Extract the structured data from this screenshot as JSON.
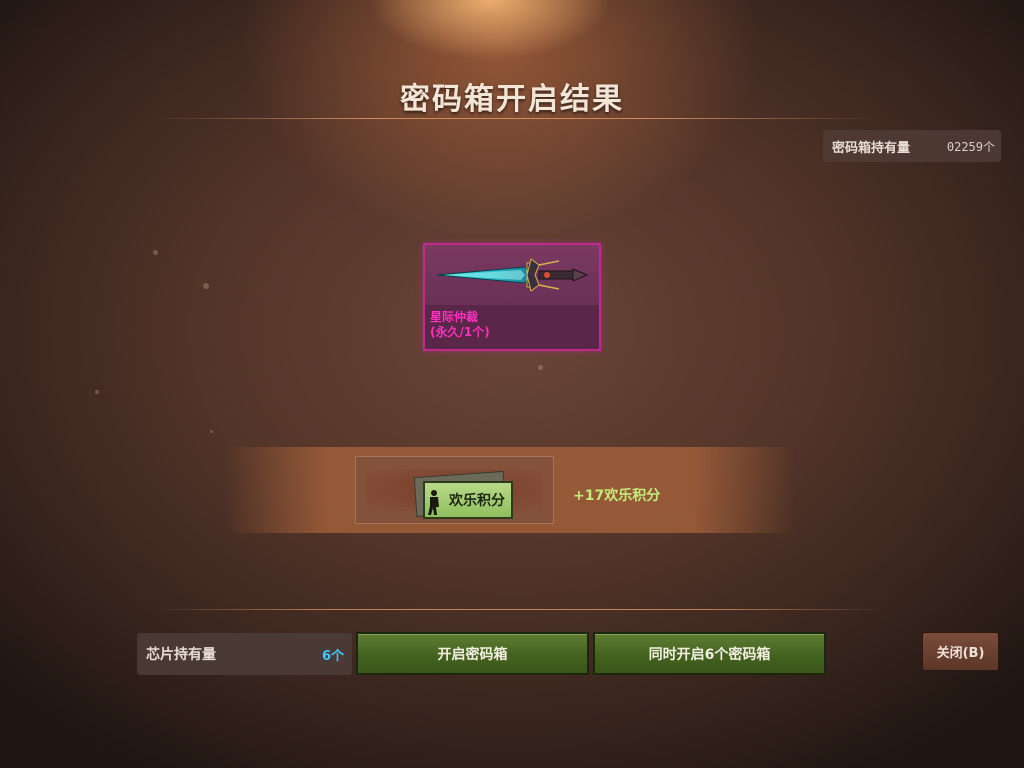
{
  "header": {
    "title": "密码箱开启结果"
  },
  "box_holdings": {
    "label": "密码箱持有量",
    "value": "02259个"
  },
  "reward": {
    "name": "星际仲裁",
    "duration": "(永久/1个)",
    "rarity_color": "#c02a90",
    "image_icon": "sword-icon"
  },
  "points": {
    "icon_label": "欢乐积分",
    "gain_text": "+17欢乐积分"
  },
  "footer": {
    "chip_holdings_label": "芯片持有量",
    "chip_holdings_value": "6个",
    "open_button": "开启密码箱",
    "open_all_button": "同时开启6个密码箱",
    "close_button": "关闭(B)"
  },
  "colors": {
    "accent_green": "#44621f",
    "points_green": "#c3ec7a",
    "chip_value_blue": "#3fc7ff",
    "item_name_pink": "#ff2fc0"
  }
}
